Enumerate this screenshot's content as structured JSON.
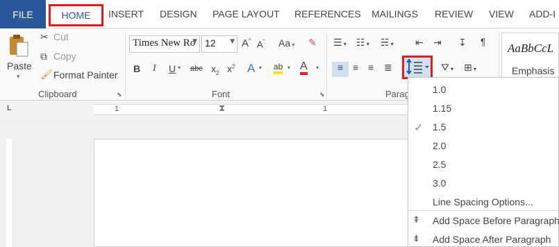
{
  "tabs": {
    "file": "FILE",
    "home": "HOME",
    "others": [
      "INSERT",
      "DESIGN",
      "PAGE LAYOUT",
      "REFERENCES",
      "MAILINGS",
      "REVIEW",
      "VIEW",
      "ADD-I"
    ]
  },
  "clipboard": {
    "paste": "Paste",
    "cut": "Cut",
    "copy": "Copy",
    "format_painter": "Format Painter",
    "label": "Clipboard"
  },
  "font": {
    "name": "Times New Ro",
    "size": "12",
    "change_case": "Aa",
    "bold": "B",
    "italic": "I",
    "underline": "U",
    "strikethrough": "abc",
    "subscript": "x",
    "superscript": "x",
    "text_effects": "A",
    "highlight": "ab",
    "font_color": "A",
    "grow": "A",
    "shrink": "A",
    "label": "Font"
  },
  "paragraph": {
    "label": "Parag"
  },
  "styles": {
    "preview": "AaBbCcL",
    "name": "Emphasis"
  },
  "ruler": {
    "left_mark": "1",
    "right_mark": "1"
  },
  "line_spacing_menu": {
    "items": [
      "1.0",
      "1.15",
      "1.5",
      "2.0",
      "2.5",
      "3.0"
    ],
    "selected": "1.5",
    "options": "Line Spacing Options...",
    "add_before": "Add Space Before Paragraph",
    "add_after": "Add Space After Paragraph"
  },
  "colors": {
    "accent": "#2b579a",
    "highlight_red": "#e41b1b",
    "check": "#6a8fd0"
  }
}
